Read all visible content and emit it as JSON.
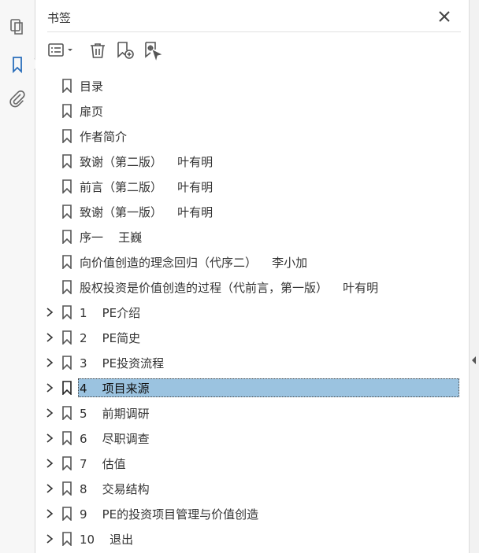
{
  "panel": {
    "title": "书签"
  },
  "rail": {
    "icons": [
      "pages-icon",
      "bookmark-icon",
      "attachment-icon"
    ]
  },
  "toolbar": {
    "buttons": [
      "options-menu-icon",
      "delete-bookmark-icon",
      "new-bookmark-icon",
      "bookmark-from-selection-icon"
    ]
  },
  "bookmarks": [
    {
      "label": "目录",
      "expandable": false
    },
    {
      "label": "扉页",
      "expandable": false
    },
    {
      "label": "作者简介",
      "expandable": false
    },
    {
      "label": "致谢（第二版）    叶有明",
      "expandable": false
    },
    {
      "label": "前言（第二版）    叶有明",
      "expandable": false
    },
    {
      "label": "致谢（第一版）    叶有明",
      "expandable": false
    },
    {
      "label": "序一    王巍",
      "expandable": false
    },
    {
      "label": "向价值创造的理念回归（代序二）    李小加",
      "expandable": false
    },
    {
      "label": "股权投资是价值创造的过程（代前言，第一版）    叶有明",
      "expandable": false
    },
    {
      "label": "1    PE介绍",
      "expandable": true
    },
    {
      "label": "2    PE简史",
      "expandable": true
    },
    {
      "label": "3    PE投资流程",
      "expandable": true
    },
    {
      "label": "4    项目来源",
      "expandable": true,
      "selected": true
    },
    {
      "label": "5    前期调研",
      "expandable": true
    },
    {
      "label": "6    尽职调查",
      "expandable": true
    },
    {
      "label": "7    估值",
      "expandable": true
    },
    {
      "label": "8    交易结构",
      "expandable": true
    },
    {
      "label": "9    PE的投资项目管理与价值创造",
      "expandable": true
    },
    {
      "label": "10    退出",
      "expandable": true
    }
  ],
  "colors": {
    "selection": "#9bc3e0",
    "accent": "#2a6ebb"
  }
}
